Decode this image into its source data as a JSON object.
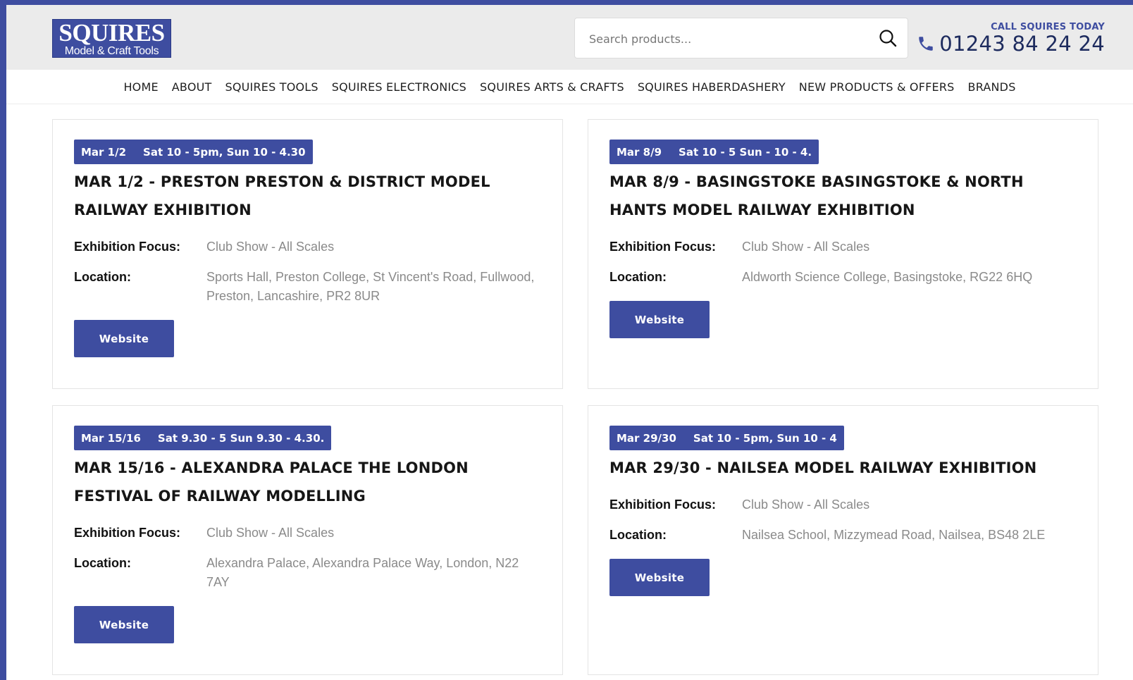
{
  "header": {
    "logo_main": "SQUIRES",
    "logo_sub": "Model & Craft Tools",
    "search_placeholder": "Search products...",
    "call_label": "CALL SQUIRES TODAY",
    "phone": "01243 84 24 24"
  },
  "nav": {
    "items": [
      "HOME",
      "ABOUT",
      "SQUIRES TOOLS",
      "SQUIRES ELECTRONICS",
      "SQUIRES ARTS & CRAFTS",
      "SQUIRES HABERDASHERY",
      "NEW PRODUCTS & OFFERS",
      "BRANDS"
    ]
  },
  "labels": {
    "focus": "Exhibition Focus:",
    "location": "Location:",
    "website": "Website"
  },
  "events": [
    {
      "date": "Mar 1/2",
      "time": "Sat 10 - 5pm, Sun 10 - 4.30",
      "title": "MAR 1/2 - PRESTON PRESTON & DISTRICT MODEL RAILWAY EXHIBITION",
      "focus": "Club Show - All Scales",
      "location": "Sports Hall, Preston College, St Vincent's Road, Fullwood, Preston, Lancashire, PR2 8UR"
    },
    {
      "date": "Mar 8/9",
      "time": "Sat 10 - 5 Sun - 10 - 4.",
      "title": "MAR 8/9 - BASINGSTOKE BASINGSTOKE & NORTH HANTS MODEL RAILWAY EXHIBITION",
      "focus": "Club Show - All Scales",
      "location": "Aldworth Science College, Basingstoke, RG22 6HQ"
    },
    {
      "date": "Mar 15/16",
      "time": "Sat 9.30 - 5 Sun 9.30 - 4.30.",
      "title": "MAR 15/16 - ALEXANDRA PALACE THE LONDON FESTIVAL OF RAILWAY MODELLING",
      "focus": "Club Show - All Scales",
      "location": "Alexandra Palace, Alexandra Palace Way, London, N22 7AY"
    },
    {
      "date": "Mar 29/30",
      "time": "Sat 10 - 5pm, Sun 10 - 4",
      "title": "MAR 29/30 - NAILSEA MODEL RAILWAY EXHIBITION",
      "focus": "Club Show - All Scales",
      "location": "Nailsea School, Mizzymead Road, Nailsea, BS48 2LE"
    }
  ],
  "colors": {
    "brand": "#3e4da0",
    "header_bg": "#ebebeb",
    "text_dark": "#161616",
    "text_muted": "#8a8a8a"
  }
}
